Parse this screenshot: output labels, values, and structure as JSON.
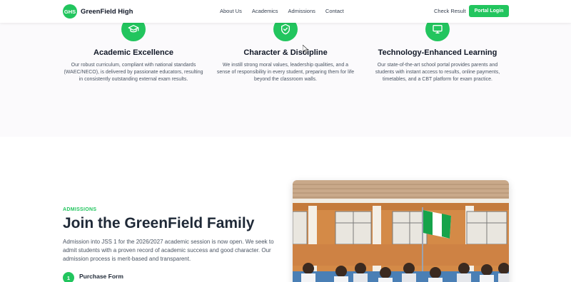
{
  "header": {
    "logo_badge": "GHS",
    "brand": "GreenField High",
    "nav": [
      "About Us",
      "Academics",
      "Admissions",
      "Contact"
    ],
    "check_result": "Check Result",
    "portal_login": "Portal Login"
  },
  "features": [
    {
      "icon": "mortarboard-icon",
      "title": "Academic Excellence",
      "description": "Our robust curriculum, compliant with national standards (WAEC/NECO), is delivered by passionate educators, resulting in consistently outstanding external exam results."
    },
    {
      "icon": "shield-check-icon",
      "title": "Character & Discipline",
      "description": "We instill strong moral values, leadership qualities, and a sense of responsibility in every student, preparing them for life beyond the classroom walls."
    },
    {
      "icon": "monitor-icon",
      "title": "Technology-Enhanced Learning",
      "description": "Our state-of-the-art school portal provides parents and students with instant access to results, online payments, timetables, and a CBT platform for exam practice."
    }
  ],
  "admissions": {
    "tag": "ADMISSIONS",
    "title": "Join the GreenField Family",
    "description": "Admission into JSS 1 for the 2026/2027 academic session is now open. We seek to admit students with a proven record of academic success and good character. Our admission process is merit-based and transparent.",
    "steps": [
      {
        "number": "1",
        "label": "Purchase Form"
      }
    ]
  },
  "colors": {
    "accent": "#22c55e",
    "heading": "#1f2937",
    "body_text": "#4b5563"
  }
}
